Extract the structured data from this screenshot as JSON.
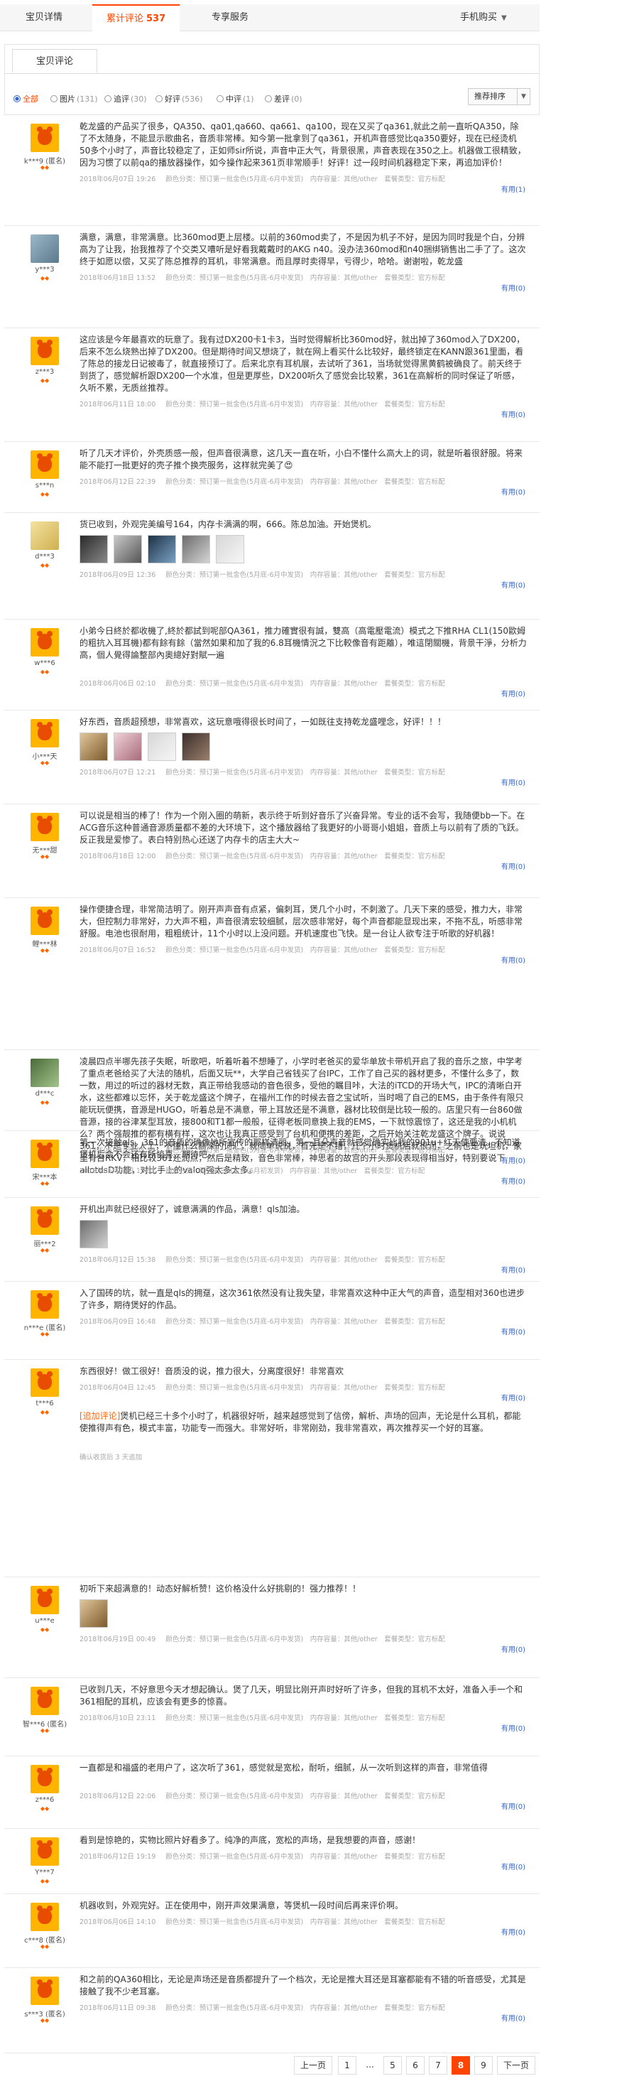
{
  "tabs": [
    {
      "label": "宝贝详情"
    },
    {
      "label": "累计评论",
      "count": "537"
    },
    {
      "label": "专享服务"
    }
  ],
  "buy_label": "手机购买",
  "subtab": "宝贝评论",
  "filters": [
    {
      "label": "全部",
      "count": ""
    },
    {
      "label": "图片",
      "count": "(131)"
    },
    {
      "label": "追评",
      "count": "(30)"
    },
    {
      "label": "好评",
      "count": "(536)"
    },
    {
      "label": "中评",
      "count": "(1)"
    },
    {
      "label": "差评",
      "count": "(0)"
    }
  ],
  "sort_label": "推荐排序",
  "useful_label": "有用",
  "reviews": [
    {
      "user": "k***9 (匿名)",
      "text": "乾龙盛的产品买了很多，QA350、qa01,qa660、qa661、qa100，现在又买了qa361,就此之前一直听QA350，除了不太随身，不能显示歌曲名，音质非常棒。知今第一批拿到了qa361，开机声音感觉比qa350要好，现在已经烫机50多个小时了，声音比较稳定了，正如师sir所说，声音中正大气，背景很黑，声音表现在350之上。机器做工很精致，因为习惯了以前qa的播放器操作，如今操作起来361页非常顺手！好评！过一段时间机器稳定下来，再追加评价！",
      "date": "2018年06月07日 19:26",
      "spec": "颜色分类：预订第一批金色(5月底-6月中发货)　内存容量：其他/other　套餐类型：官方标配",
      "useful": "(1)"
    },
    {
      "user": "y***3",
      "text": "满意，满意，非常满意。比360mod更上层楼。以前的360mod卖了，不是因为机子不好，是因为同时我是个白，分辨高为了让我，抬我推荐了个交类又嘈听是好看我戴戴时的AKG n40。没办法360mod和n40捆绑销售出二手了了。这次终于如愿以偿，又买了陈总推荐的耳机，非常满意。而且厚时卖得早，亏得少，哈哈。谢谢啦，乾龙盛",
      "date": "2018年06月18日 13:52",
      "spec": "颜色分类：预订第一批金色(5月底-6月中发货)　内存容量：其他/other　套餐类型：官方标配",
      "useful": "(0)"
    },
    {
      "user": "z***3",
      "text": "这应该是今年最喜欢的玩意了。我有过DX200卡1卡3，当时觉得解析比360mod好，就出掉了360mod入了DX200，后来不怎么烧熟出掉了DX200。但是期待时间又想烧了，就在网上看买什么比较好，最终锁定在KANN跟361里面，看了陈总的接龙日记被毒了，就直接预订了。后来北京有耳机展，去试听了361，当场就觉得黑黄鹤被确良了。前天终于到货了，感觉解析跟DX200一个水准，但是更厚些，DX200听久了感觉会比较累，361在高解析的同时保证了听感，久听不累，无质丝推荐。",
      "date": "2018年06月11日 18:00",
      "spec": "颜色分类：预订第一批金色(5月底-6月中发货)　内存容量：其他/other　套餐类型：官方标配",
      "useful": "(0)"
    },
    {
      "user": "s***n",
      "text": "听了几天才评价，外壳质感一般，但声音很满意，这几天一直在听，小白不懂什么高大上的词，就是听着很舒服。将来能不能打一批更好的壳子推个换壳服务，这样就完美了😍",
      "date": "2018年06月12日 22:39",
      "spec": "颜色分类：预订第一批金色(5月底-6月中发货)　内存容量：其他/other　套餐类型：官方标配",
      "useful": "(0)"
    },
    {
      "user": "d***3",
      "text": "货已收到，外观完美编号164，内存卡满满的啊，666。陈总加油。开始煲机。",
      "date": "2018年06月09日 12:36",
      "spec": "颜色分类：预订第一批金色(5月底-6月中发货)　内存容量：其他/other　套餐类型：官方标配",
      "useful": "(0)"
    },
    {
      "user": "w***6",
      "text": "小弟今日終於都收機了,終於都試到呢部QA361，推力確實很有誠，雙高（高電壓電流）模式之下推RHA CL1(150歐姆的粗抗入耳耳機)都有餘有餘（當然如果和加了我的6.8耳機情況之下比較像音有距離），唯這閉關機，背景干淨，分析力高，個人覺得論整部內奧總好對賦一遍",
      "date": "2018年06月06日 02:10",
      "spec": "颜色分类：预订第一批金色(5月底-6月中发货)　内存容量：其他/other　套餐类型：官方标配",
      "useful": "(0)"
    },
    {
      "user": "小***天",
      "text": "好东西，音质超预想，非常喜欢，这玩意哦得很长时间了，一如既往支持乾龙盛哩念，好评！！！",
      "date": "2018年06月07日 12:21",
      "spec": "颜色分类：预订第一批金色(5月底-6月中发货)　内存容量：其他/other　套餐类型：官方标配",
      "useful": "(0)"
    },
    {
      "user": "无***甜",
      "text": "可以说是相当的棒了！作为一个刚入圈的萌新，表示终于听到好音乐了兴奋异常。专业的话不会写，我随便bb一下。在ACG音乐这种普通音源质量都不差的大环境下，这个播放器给了我更好的小哥哥小姐姐，音质上与以前有了质的飞跃。反正我是爱惨了。表白特别热心还送了内存卡的店主大大~",
      "date": "2018年06月18日 12:00",
      "spec": "颜色分类：预订第一批金色(5月底-6月中发货)　内存容量：其他/other　套餐类型：官方标配",
      "useful": "(0)"
    },
    {
      "user": "鲤***林",
      "text": "操作便捷合理，非常简洁明了。刚开声声音有点紧，偏刺耳，煲几个小时，不刺激了。几天下来的感受，推力大，非常大，但控制力非常好，力大声不粗，声音很清宏较细腻，层次感非常好，每个声音都能显现出来，不拖不乱，听感非常舒服。电池也很耐用，粗粗统计，11个小时以上没问题。开机速度也飞快。是一台让人欲专注于听歌的好机器！",
      "date": "2018年06月07日 16:52",
      "spec": "颜色分类：预订第一批金色(5月底-6月中发货)　内存容量：其他/other　套餐类型：官方标配",
      "useful": "(0)"
    },
    {
      "user": "d***c",
      "text": "凌晨四点半哪先孩子失眠，听歌吧，听着听着不想睡了，小学时老爸买的爱华单放卡带机开启了我的音乐之旅，中学考了重点老爸给买了大法的随机，后面又玩**，大学自己省钱买了台IPC，工作了自己买的器材更多，不懂什么多了，数一数，用过的听过的器材无数，真正带给我感动的音色很多，受他的瞩目咔，大法的iTCD的开场大气，IPC的清晰白开水，这些都难以忘怀，关于乾龙盛这个牌子，在福州工作的时候去音之宝试听，当时喝了自己的EMS，由于条件有限只能玩玩便携，音源是HUGO，听着总是不满意，带上耳放还是不满意，器材比较倒是比较一般的。店里只有一台860做音源，接的谷津某型耳放，接800和T1都一般般，征得老板同意换上我的EMS，一下就惊震惊了，这还是我的小机机么？两个强靓推的都有横有样，这次也让我真正感受到了台机和便携的差距，之后开始关注乾龙盛这个牌子。说说361，不是专业人士，不懂什么高深的词汇，就简单说说，首先是不错，几个小时煲机后就很润，之前也是玩坦机，家里有台RKV，相比较361还润点，然后是精致，音色非常棒，神思者的故宫的开头那段表现得相当好，特别要说下allotdsD功能，对比手上的valoq强太多太多。",
      "date": "2018年06月18日 05:22",
      "spec": "颜色分类：预订第一批金色(5月底-6月中发货)　内存容量：其他/other　套餐类型：官方标配",
      "useful": "(0)"
    },
    {
      "user": "宋***本",
      "text": "第一次接触qls。361的音质的确像她所宣传的那样清丽，第一耳朵声音就感觉确实比我的901u+红天使要清。不知道煲机后会不会还有所惊喜，期待吧。",
      "date": "2018年05月25日 13:51",
      "spec": "颜色分类：预订第三批金色(6月初发货)　内存容量：其他/other　套餐类型：官方标配",
      "useful": "(0)"
    },
    {
      "user": "丽***2",
      "text": "开机出声就已经很好了，诚意满满的作品，满意！qls加油。",
      "date": "2018年06月12日 15:38",
      "spec": "颜色分类：预订第一批金色(5月底-6月中发货)　内存容量：其他/other　套餐类型：官方标配",
      "useful": "(0)"
    },
    {
      "user": "n***e (匿名)",
      "text": "入了国砖的坑，就一直是qls的拥趸，这次361依然没有让我失望，非常喜欢这种中正大气的声音，造型相对360也进步了许多，期待煲好的作品。",
      "date": "2018年06月09日 16:48",
      "spec": "颜色分类：预订第一批金色(5月底-6月中发货)　内存容量：其他/other　套餐类型：官方标配",
      "useful": "(0)"
    },
    {
      "user": "t***6",
      "text": "东西很好！做工很好！音质没的说，推力很大，分离度很好！非常喜欢",
      "date": "2018年06月04日 12:45",
      "spec": "颜色分类：预订第一批金色(5月底-6月中发货)　内存容量：其他/other　套餐类型：官方标配",
      "useful": "(0)",
      "append_label": "[追加评论]",
      "append_text": "煲机已经三十多个小时了，机器很好听，越来越感觉到了信傍，解析、声场的回声，无论是什么耳机，都能使推得声有色，模式丰富，功能专一而强大。非常好听，非常刚劲，我非常喜欢，再次推荐买一个好的耳塞。",
      "append_time": "确认收货后 3 天追加"
    },
    {
      "user": "u***e",
      "text": "初听下来超满意的！动态好解析赞！这价格没什么好挑剔的！强力推荐！！",
      "date": "2018年06月19日 00:49",
      "spec": "颜色分类：预订第一批金色(5月底-6月中发货)　内存容量：其他/other　套餐类型：官方标配",
      "useful": "(0)"
    },
    {
      "user": "智***6 (匿名)",
      "text": "已收到几天，不好意思今天才想起确认。煲了几天，明显比刚开声时好听了许多，但我的耳机不太好，准备入手一个和361相配的耳机，应该会有更多的惊喜。",
      "date": "2018年06月10日 23:11",
      "spec": "颜色分类：预订第一批金色(5月底-6月中发货)　内存容量：其他/other　套餐类型：官方标配",
      "useful": "(0)"
    },
    {
      "user": "z***6",
      "text": "一直都是和福盛的老用户了，这次听了361，感觉就是宽松，耐听，细腻，从一次听到这样的声音，非常值得",
      "date": "2018年06月12日 22:06",
      "spec": "颜色分类：预订第一批金色(5月底-6月中发货)　内存容量：其他/other　套餐类型：官方标配",
      "useful": "(0)"
    },
    {
      "user": "Y***7",
      "text": "看到是惊艳的，实物比照片好看多了。纯净的声底，宽松的声场，是我想要的声音，感谢！",
      "date": "2018年06月12日 19:19",
      "spec": "颜色分类：预订第一批金色(5月底-6月中发货)　内存容量：其他/other　套餐类型：官方标配",
      "useful": "(0)"
    },
    {
      "user": "c***8 (匿名)",
      "text": "机器收到，外观完好。正在使用中，刚开声效果满意，等煲机一段时间后再来评价啊。",
      "date": "2018年06月06日 14:10",
      "spec": "颜色分类：预订第一批金色(5月底-6月中发货)　内存容量：其他/other　套餐类型：官方标配",
      "useful": "(0)"
    },
    {
      "user": "s***3 (匿名)",
      "text": "和之前的QA360相比，无论是声场还是音质都提升了一个档次，无论是推大耳还是耳塞都能有不错的听音感受，尤其是接触了我不少老耳塞。",
      "date": "2018年06月11日 09:38",
      "spec": "颜色分类：预订第一批金色(5月底-6月中发货)　内存容量：其他/other　套餐类型：官方标配",
      "useful": "(0)"
    }
  ],
  "pager": {
    "prev": "上一页",
    "p1": "1",
    "dots": "...",
    "p5": "5",
    "p6": "6",
    "p7": "7",
    "p8": "8",
    "p9": "9",
    "next": "下一页"
  }
}
